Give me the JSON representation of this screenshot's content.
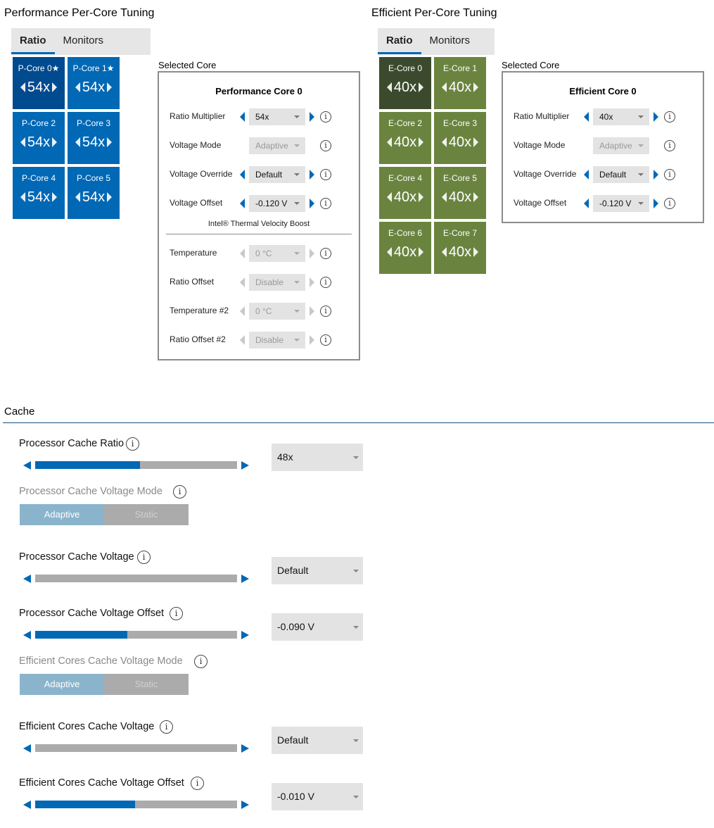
{
  "performance": {
    "title": "Performance Per-Core Tuning",
    "tabs": [
      "Ratio",
      "Monitors"
    ],
    "active_tab": "Ratio",
    "cores": [
      {
        "name": "P-Core 0",
        "value": "54x",
        "favored": true,
        "selected": true
      },
      {
        "name": "P-Core 1",
        "value": "54x",
        "favored": true,
        "selected": false
      },
      {
        "name": "P-Core 2",
        "value": "54x",
        "favored": false,
        "selected": false
      },
      {
        "name": "P-Core 3",
        "value": "54x",
        "favored": false,
        "selected": false
      },
      {
        "name": "P-Core 4",
        "value": "54x",
        "favored": false,
        "selected": false
      },
      {
        "name": "P-Core 5",
        "value": "54x",
        "favored": false,
        "selected": false
      }
    ],
    "selected_core": {
      "label": "Selected Core",
      "title": "Performance Core 0",
      "rows": [
        {
          "label": "Ratio Multiplier",
          "value": "54x",
          "enabled": true
        },
        {
          "label": "Voltage Mode",
          "value": "Adaptive",
          "enabled": false
        },
        {
          "label": "Voltage Override",
          "value": "Default",
          "enabled": true
        },
        {
          "label": "Voltage Offset",
          "value": "-0.120 V",
          "enabled": true
        }
      ],
      "tvb_title": "Intel® Thermal Velocity Boost",
      "tvb_rows": [
        {
          "label": "Temperature",
          "value": "0 °C",
          "enabled": false
        },
        {
          "label": "Ratio Offset",
          "value": "Disable",
          "enabled": false
        },
        {
          "label": "Temperature #2",
          "value": "0 °C",
          "enabled": false
        },
        {
          "label": "Ratio Offset #2",
          "value": "Disable",
          "enabled": false
        }
      ]
    }
  },
  "efficient": {
    "title": "Efficient Per-Core Tuning",
    "tabs": [
      "Ratio",
      "Monitors"
    ],
    "active_tab": "Ratio",
    "cores": [
      {
        "name": "E-Core 0",
        "value": "40x",
        "selected": true
      },
      {
        "name": "E-Core 1",
        "value": "40x",
        "selected": false
      },
      {
        "name": "E-Core 2",
        "value": "40x",
        "selected": false
      },
      {
        "name": "E-Core 3",
        "value": "40x",
        "selected": false
      },
      {
        "name": "E-Core 4",
        "value": "40x",
        "selected": false
      },
      {
        "name": "E-Core 5",
        "value": "40x",
        "selected": false
      },
      {
        "name": "E-Core 6",
        "value": "40x",
        "selected": false
      },
      {
        "name": "E-Core 7",
        "value": "40x",
        "selected": false
      }
    ],
    "selected_core": {
      "label": "Selected Core",
      "title": "Efficient Core 0",
      "rows": [
        {
          "label": "Ratio Multiplier",
          "value": "40x",
          "enabled": true
        },
        {
          "label": "Voltage Mode",
          "value": "Adaptive",
          "enabled": false
        },
        {
          "label": "Voltage Override",
          "value": "Default",
          "enabled": true
        },
        {
          "label": "Voltage Offset",
          "value": "-0.120 V",
          "enabled": true
        }
      ]
    }
  },
  "cache": {
    "title": "Cache",
    "processor_cache_ratio": {
      "label": "Processor Cache Ratio",
      "value": "48x",
      "slider_fraction": 0.52
    },
    "processor_cache_voltage_mode": {
      "label": "Processor Cache Voltage Mode",
      "options": [
        "Adaptive",
        "Static"
      ],
      "selected": "Adaptive",
      "enabled": false
    },
    "processor_cache_voltage": {
      "label": "Processor Cache Voltage",
      "value": "Default",
      "slider_fraction": 0.0
    },
    "processor_cache_voltage_offset": {
      "label": "Processor Cache Voltage Offset",
      "value": "-0.090 V",
      "slider_fraction": 0.455
    },
    "efficient_cache_voltage_mode": {
      "label": "Efficient Cores Cache Voltage Mode",
      "options": [
        "Adaptive",
        "Static"
      ],
      "selected": "Adaptive",
      "enabled": false
    },
    "efficient_cache_voltage": {
      "label": "Efficient Cores Cache Voltage",
      "value": "Default",
      "slider_fraction": 0.0
    },
    "efficient_cache_voltage_offset": {
      "label": "Efficient Cores Cache Voltage Offset",
      "value": "-0.010 V",
      "slider_fraction": 0.495
    }
  },
  "icons": {
    "info": "info-icon",
    "favored": "star-icon",
    "decrement": "left-triangle-icon",
    "increment": "right-triangle-icon"
  },
  "colors": {
    "accent": "#0068b5",
    "p_core": "#0068b5",
    "p_core_selected": "#004a8f",
    "e_core": "#6a8440",
    "e_core_selected": "#3b4a2c"
  }
}
